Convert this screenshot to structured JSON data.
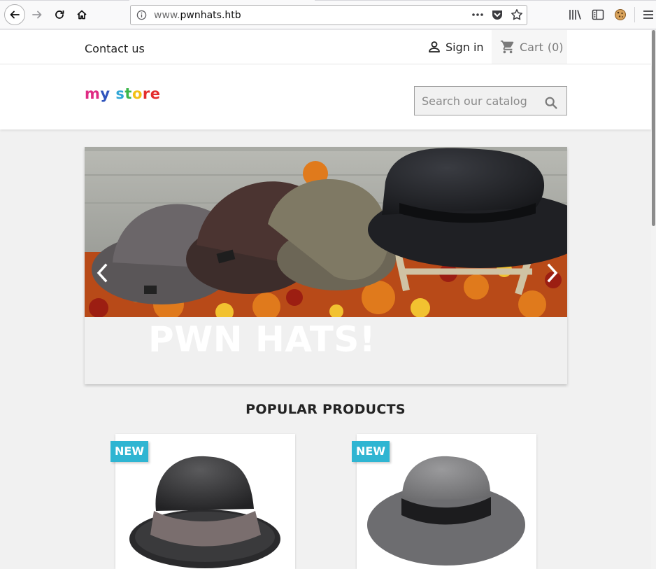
{
  "browser": {
    "url_prefix": "www.",
    "url_domain": "pwnhats.htb"
  },
  "header": {
    "contact_label": "Contact us",
    "signin_label": "Sign in",
    "cart_label": "Cart",
    "cart_count": "(0)"
  },
  "logo": {
    "letters": [
      "m",
      "y",
      " ",
      "s",
      "t",
      "o",
      "r",
      "e"
    ],
    "colors": [
      "#df2b83",
      "#2f54bd",
      "#ffffff",
      "#2fa6d6",
      "#3cb64a",
      "#f3c116",
      "#e32c2c",
      "#e32c2c"
    ]
  },
  "search": {
    "placeholder": "Search our catalog"
  },
  "carousel": {
    "caption": "PWN HATS!"
  },
  "products": {
    "section_title": "POPULAR PRODUCTS",
    "items": [
      {
        "badge": "NEW",
        "image": "black-fedora-hat"
      },
      {
        "badge": "NEW",
        "image": "grey-fedora-hat"
      }
    ]
  },
  "colors": {
    "accent": "#2fb5d2",
    "page_bg": "#f1f1f1"
  }
}
